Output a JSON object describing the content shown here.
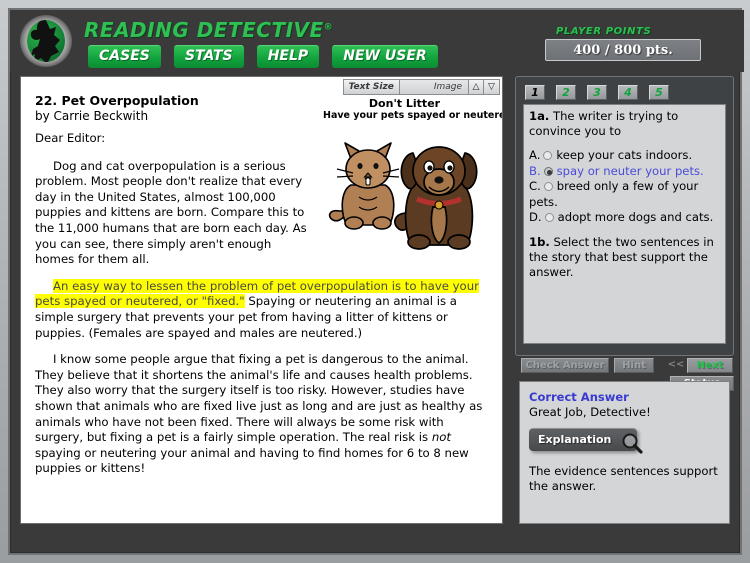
{
  "header": {
    "brand": "READING DETECTIVE",
    "brand_mark": "®",
    "logo_icon": "detective-globe-logo",
    "nav": [
      {
        "label": "CASES"
      },
      {
        "label": "STATS"
      },
      {
        "label": "HELP"
      },
      {
        "label": "NEW USER"
      }
    ],
    "points_label": "PLAYER POINTS",
    "points_value": "400 / 800 pts."
  },
  "toolbar": {
    "text_size_label": "Text Size",
    "image_label": "Image",
    "up_arrow": "△",
    "down_arrow": "▽"
  },
  "story": {
    "title": "22. Pet Overpopulation",
    "author": "by  Carrie Beckwith",
    "figure": {
      "caption_line1": "Don't Litter",
      "caption_line2": "Have your pets spayed or neutered",
      "icon": "cat-and-dog-illustration"
    },
    "salutation": "Dear Editor:",
    "p1": "Dog and cat overpopulation is a serious problem. Most people don't realize that every day in the United States, almost 100,000 puppies and kittens are born. Compare this to the 11,000 humans that are born each day. As you can see, there simply aren't enough homes for them all.",
    "p2_highlight": "An easy way to lessen the problem of pet overpopulation is to have your pets spayed or neutered, or \"fixed.\"",
    "p2_rest": " Spaying or neutering an animal is a simple surgery that prevents your pet from having a litter of kittens or puppies. (Females are spayed and males are neutered.)",
    "p3_a": "I know some people argue that fixing a pet is dangerous to the animal. They believe that it shortens the animal's life and causes health problems. They also worry that the surgery itself is too risky. However, studies have shown that animals who are fixed live just as long and are just as healthy as animals who have not been fixed. There will always be some risk with surgery, but fixing a pet is a fairly simple operation. The real risk is ",
    "p3_italic": "not",
    "p3_b": " spaying or neutering your animal and having to find homes for 6 to 8 new puppies or kittens!"
  },
  "question": {
    "tabs": [
      {
        "label": "1",
        "active": true
      },
      {
        "label": "2",
        "active": false
      },
      {
        "label": "3",
        "active": false
      },
      {
        "label": "4",
        "active": false
      },
      {
        "label": "5",
        "active": false
      }
    ],
    "q1a_number": "1a.",
    "q1a_text": " The writer is trying to convince you to",
    "options": [
      {
        "letter": "A.",
        "text": "keep your cats indoors.",
        "selected": false
      },
      {
        "letter": "B.",
        "text": "spay or neuter your pets.",
        "selected": true
      },
      {
        "letter": "C.",
        "text": "breed only a few of your pets.",
        "selected": false
      },
      {
        "letter": "D.",
        "text": "adopt more dogs and cats.",
        "selected": false
      }
    ],
    "q1b_number": "1b.",
    "q1b_text": " Select the two sentences in the story that best support the answer."
  },
  "controls": {
    "check_answer": "Check Answer",
    "hint": "Hint",
    "prev": "<<",
    "next": "Next >>",
    "status": "Status"
  },
  "answer": {
    "title": "Correct Answer",
    "subtitle": "Great Job, Detective!",
    "explanation_button": "Explanation",
    "explanation_icon": "magnifying-glass-icon",
    "body": "The evidence sentences support the answer."
  },
  "colors": {
    "brand_green": "#2fbf52",
    "button_green": "#12a33e",
    "highlight_yellow": "#ffff00",
    "selected_blue": "#4b4bd8",
    "answer_blue": "#3a3ad0",
    "panel_gray": "#d3d5d7",
    "app_dark": "#3a3a3a"
  }
}
